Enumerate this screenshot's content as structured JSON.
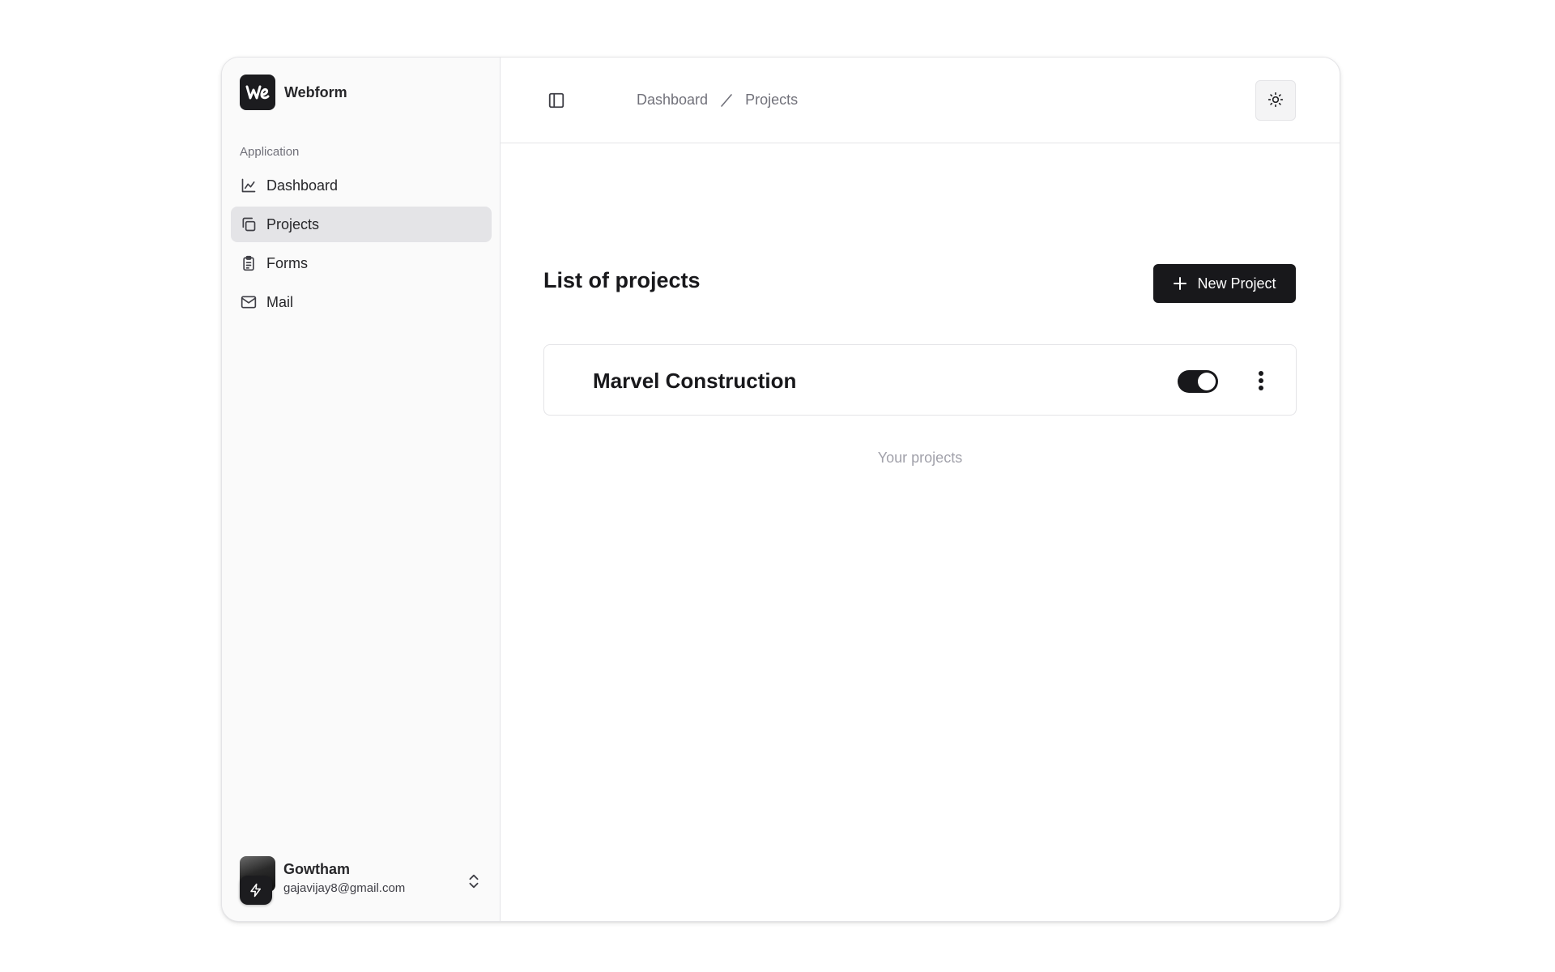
{
  "brand": {
    "name": "Webform",
    "logo_text": "We"
  },
  "sidebar": {
    "group_label": "Application",
    "items": [
      {
        "label": "Dashboard",
        "icon": "chart-line-icon",
        "active": false
      },
      {
        "label": "Projects",
        "icon": "copy-icon",
        "active": true
      },
      {
        "label": "Forms",
        "icon": "clipboard-list-icon",
        "active": false
      },
      {
        "label": "Mail",
        "icon": "mail-icon",
        "active": false
      }
    ]
  },
  "user": {
    "name": "Gowtham",
    "email": "gajavijay8@gmail.com"
  },
  "topbar": {
    "breadcrumb": [
      "Dashboard",
      "Projects"
    ]
  },
  "main": {
    "title": "List of projects",
    "new_button_label": "New Project",
    "projects": [
      {
        "name": "Marvel Construction",
        "enabled": true
      }
    ],
    "caption": "Your projects"
  },
  "colors": {
    "primary": "#18181b",
    "sidebar_bg": "#fafafa",
    "active_bg": "#e4e4e7",
    "muted_text": "#71717a"
  }
}
